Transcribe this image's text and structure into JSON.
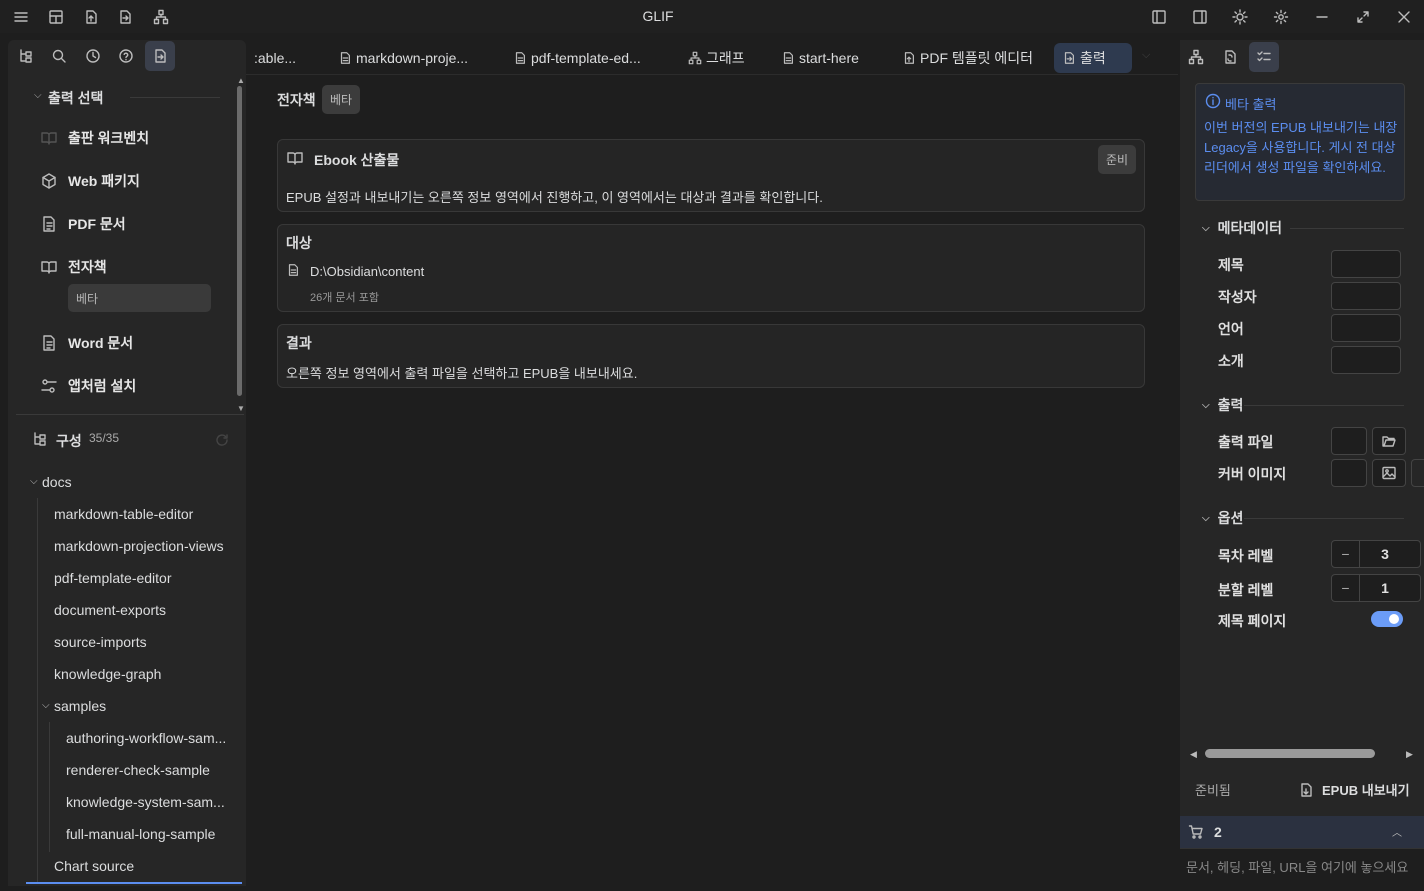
{
  "app": {
    "title": "GLIF"
  },
  "left": {
    "output_section": "출력 선택",
    "outputs": [
      {
        "label": "출판 워크벤치"
      },
      {
        "label": "Web 패키지"
      },
      {
        "label": "PDF 문서"
      },
      {
        "label": "전자책"
      },
      {
        "label": "Word 문서"
      },
      {
        "label": "앱처럼 설치"
      }
    ],
    "selected_badge": "베타",
    "composition": {
      "title": "구성",
      "count": "35/35"
    },
    "tree": [
      "docs",
      "markdown-table-editor",
      "markdown-projection-views",
      "pdf-template-editor",
      "document-exports",
      "source-imports",
      "knowledge-graph",
      "samples",
      "authoring-workflow-sam...",
      "renderer-check-sample",
      "knowledge-system-sam...",
      "full-manual-long-sample",
      "Chart source"
    ]
  },
  "tabs": [
    {
      "label": ":able..."
    },
    {
      "label": "markdown-proje..."
    },
    {
      "label": "pdf-template-ed..."
    },
    {
      "label": "그래프"
    },
    {
      "label": "start-here"
    },
    {
      "label": "PDF 템플릿 에디터"
    },
    {
      "label": "출력"
    }
  ],
  "main": {
    "heading": "전자책",
    "heading_badge": "베타",
    "ebook_card": {
      "title": "Ebook 산출물",
      "status": "준비",
      "desc": "EPUB 설정과 내보내기는 오른쪽 정보 영역에서 진행하고, 이 영역에서는 대상과 결과를 확인합니다."
    },
    "target_card": {
      "title": "대상",
      "path": "D:\\Obsidian\\content",
      "count": "26개 문서 포함"
    },
    "result_card": {
      "title": "결과",
      "text": "오른쪽 정보 영역에서 출력 파일을 선택하고 EPUB을 내보내세요."
    }
  },
  "right": {
    "notice_title": "베타 출력",
    "notice_body": "이번 버전의 EPUB 내보내기는 내장 Legacy을 사용합니다. 게시 전 대상 리더에서 생성 파일을 확인하세요.",
    "metadata_head": "메타데이터",
    "meta_fields": [
      "제목",
      "작성자",
      "언어",
      "소개"
    ],
    "output_head": "출력",
    "output_file_label": "출력 파일",
    "cover_label": "커버 이미지",
    "options_head": "옵션",
    "toc_label": "목차 레벨",
    "toc_value": "3",
    "split_label": "분할 레벨",
    "split_value": "1",
    "title_page_label": "제목 페이지",
    "status": "준비됨",
    "export_label": "EPUB 내보내기",
    "cart_count": "2",
    "drop_placeholder": "문서, 헤딩, 파일, URL을 여기에 놓으세요"
  },
  "colors": {
    "accent": "#5b8def",
    "toggle": "#6b9cf7"
  }
}
